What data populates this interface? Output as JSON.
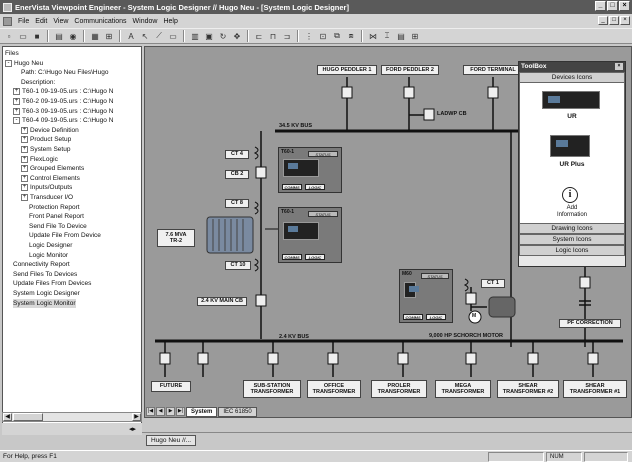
{
  "window": {
    "title": "EnerVista Viewpoint Engineer - System Logic Designer // Hugo Neu - [System Logic Designer]",
    "controls": [
      "_",
      "□",
      "×"
    ]
  },
  "menu": {
    "items": [
      "File",
      "Edit",
      "View",
      "Communications",
      "Window",
      "Help"
    ],
    "mdi_controls": [
      "_",
      "□",
      "×"
    ]
  },
  "toolbar": {
    "icons": [
      "new-icon",
      "open-icon",
      "save-icon",
      "print-icon",
      "connect-icon",
      "grid-icon",
      "zoom-icon",
      "text-icon",
      "pointer-icon",
      "line-icon",
      "bus-icon",
      "align-icon",
      "group-icon",
      "rotate-icon",
      "pan-icon"
    ]
  },
  "tree": {
    "items": [
      {
        "label": "Files",
        "indent": 0,
        "exp": ""
      },
      {
        "label": "Hugo Neu",
        "indent": 0,
        "exp": "-"
      },
      {
        "label": "Path: C:\\Hugo Neu Files\\Hugo",
        "indent": 2,
        "exp": ""
      },
      {
        "label": "Description:",
        "indent": 2,
        "exp": ""
      },
      {
        "label": "T60-1 09-19-05.urs : C:\\Hugo N",
        "indent": 1,
        "exp": "+"
      },
      {
        "label": "T60-2 09-19-05.urs : C:\\Hugo N",
        "indent": 1,
        "exp": "+"
      },
      {
        "label": "T60-3 09-19-05.urs : C:\\Hugo N",
        "indent": 1,
        "exp": "+"
      },
      {
        "label": "T60-4 09-19-05.urs : C:\\Hugo N",
        "indent": 1,
        "exp": "-"
      },
      {
        "label": "Device Definition",
        "indent": 2,
        "exp": "+"
      },
      {
        "label": "Product Setup",
        "indent": 2,
        "exp": "+"
      },
      {
        "label": "System Setup",
        "indent": 2,
        "exp": "+"
      },
      {
        "label": "FlexLogic",
        "indent": 2,
        "exp": "+"
      },
      {
        "label": "Grouped Elements",
        "indent": 2,
        "exp": "+"
      },
      {
        "label": "Control Elements",
        "indent": 2,
        "exp": "+"
      },
      {
        "label": "Inputs/Outputs",
        "indent": 2,
        "exp": "+"
      },
      {
        "label": "Transducer I/O",
        "indent": 2,
        "exp": "+"
      },
      {
        "label": "Protection Report",
        "indent": 3,
        "exp": ""
      },
      {
        "label": "Front Panel Report",
        "indent": 3,
        "exp": ""
      },
      {
        "label": "Send File To Device",
        "indent": 3,
        "exp": ""
      },
      {
        "label": "Update File From Device",
        "indent": 3,
        "exp": ""
      },
      {
        "label": "Logic Designer",
        "indent": 3,
        "exp": ""
      },
      {
        "label": "Logic Monitor",
        "indent": 3,
        "exp": ""
      },
      {
        "label": "Connectivity Report",
        "indent": 1,
        "exp": ""
      },
      {
        "label": "Send Files To Devices",
        "indent": 1,
        "exp": ""
      },
      {
        "label": "Update Files From Devices",
        "indent": 1,
        "exp": ""
      },
      {
        "label": "System Logic Designer",
        "indent": 1,
        "exp": ""
      },
      {
        "label": "System Logic Monitor",
        "indent": 1,
        "exp": "",
        "selected": true
      }
    ]
  },
  "diagram": {
    "feeders_top": [
      "HUGO PEDDLER 1",
      "FORD PEDDLER 2",
      "FORD TERMINAL"
    ],
    "ladwp_cb": "LADWP CB",
    "bus_345": "34.5 KV BUS",
    "ct4": "CT 4",
    "cb2": "CB 2",
    "ct8": "CT 8",
    "ct10": "CT 10",
    "transformer": "7.6 MVA\nTR-2",
    "main_cb": "2.4 KV MAIN CB",
    "bus_24": "2.4 KV BUS",
    "relays": [
      {
        "name": "T60-1",
        "status": "STATUS",
        "comms": "COMMS",
        "logic": "LOGIC"
      },
      {
        "name": "T60-1",
        "status": "STATUS",
        "comms": "COMMS",
        "logic": "LOGIC"
      },
      {
        "name": "M60",
        "status": "STATUS",
        "comms": "COMMS",
        "logic": "LOGIC"
      }
    ],
    "ct1": "CT 1",
    "motor_m": "M",
    "motor": "9,000 HP SCHORCH MOTOR",
    "pf": "PF CORRECTION",
    "loads": [
      "FUTURE",
      "SUB-STATION\nTRANSFORMER",
      "OFFICE\nTRANSFORMER",
      "PROLER\nTRANSFORMER",
      "MEGA\nTRANSFORMER",
      "SHEAR\nTRANSFORMER #2",
      "SHEAR\nTRANSFORMER #1"
    ]
  },
  "toolbox": {
    "title": "ToolBox",
    "close": "×",
    "sections": [
      "Devices Icons",
      "Drawing Icons",
      "System Icons",
      "Logic Icons"
    ],
    "devices": [
      {
        "label": "UR"
      },
      {
        "label": "UR Plus"
      }
    ],
    "info_label": "Add\nInformation",
    "info_symbol": "i"
  },
  "tabs": {
    "nav": [
      "|◀",
      "◀",
      "▶",
      "▶|"
    ],
    "items": [
      {
        "label": "System",
        "active": true
      },
      {
        "label": "IEC 61850",
        "active": false
      }
    ]
  },
  "taskbar": {
    "item": "Hugo Neu //..."
  },
  "status": {
    "help_text": "For Help, press F1",
    "num": "NUM"
  }
}
